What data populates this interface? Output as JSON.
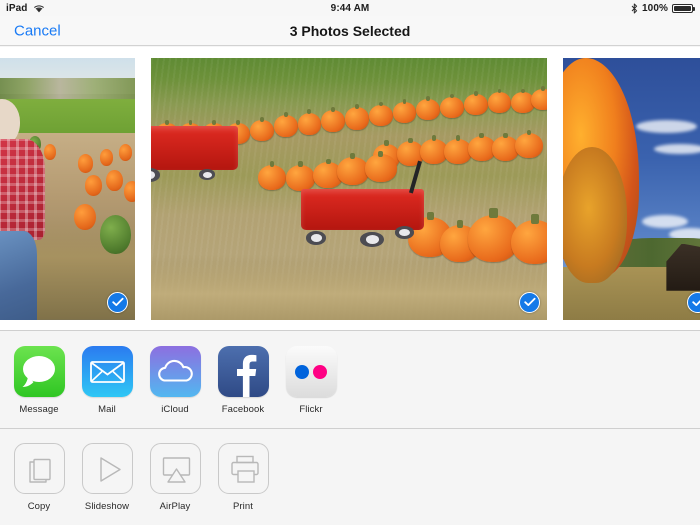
{
  "statusbar": {
    "device": "iPad",
    "wifi_icon": "wifi-icon",
    "time": "9:44 AM",
    "bluetooth_icon": "bluetooth-icon",
    "battery_percent": "100%",
    "battery_icon": "battery-full-icon"
  },
  "navbar": {
    "cancel_label": "Cancel",
    "title": "3 Photos Selected"
  },
  "photos": [
    {
      "name": "photo-child-pumpkin-patch",
      "alt": "Child in red plaid shirt and blue jeans kneeling in a pumpkin patch",
      "selected": true,
      "check_icon": "checkmark-circle-icon"
    },
    {
      "name": "photo-red-wagons-pumpkins",
      "alt": "Two red wagons parked among rows of orange pumpkins in a field",
      "selected": true,
      "check_icon": "checkmark-circle-icon"
    },
    {
      "name": "photo-autumn-tree-barn",
      "alt": "Orange autumn maple tree against a deep blue sky with a dark barn",
      "selected": true,
      "check_icon": "checkmark-circle-icon"
    }
  ],
  "share_targets": [
    {
      "label": "Message",
      "icon": "message-bubble-icon",
      "color": "#37c522"
    },
    {
      "label": "Mail",
      "icon": "envelope-icon",
      "color": "#2b8cf0"
    },
    {
      "label": "iCloud",
      "icon": "cloud-icon",
      "color": "#6f8fe4"
    },
    {
      "label": "Facebook",
      "icon": "facebook-f-icon",
      "color": "#3b5998"
    },
    {
      "label": "Flickr",
      "icon": "flickr-dots-icon",
      "color": "#ff0084"
    }
  ],
  "actions": [
    {
      "label": "Copy",
      "icon": "copy-documents-icon"
    },
    {
      "label": "Slideshow",
      "icon": "play-triangle-icon"
    },
    {
      "label": "AirPlay",
      "icon": "airplay-icon"
    },
    {
      "label": "Print",
      "icon": "printer-icon"
    }
  ],
  "colors": {
    "accent": "#1a7bf5",
    "selection_badge": "#1479e8",
    "nav_background": "#f8f8f8",
    "sheet_background": "#f5f5f5"
  }
}
